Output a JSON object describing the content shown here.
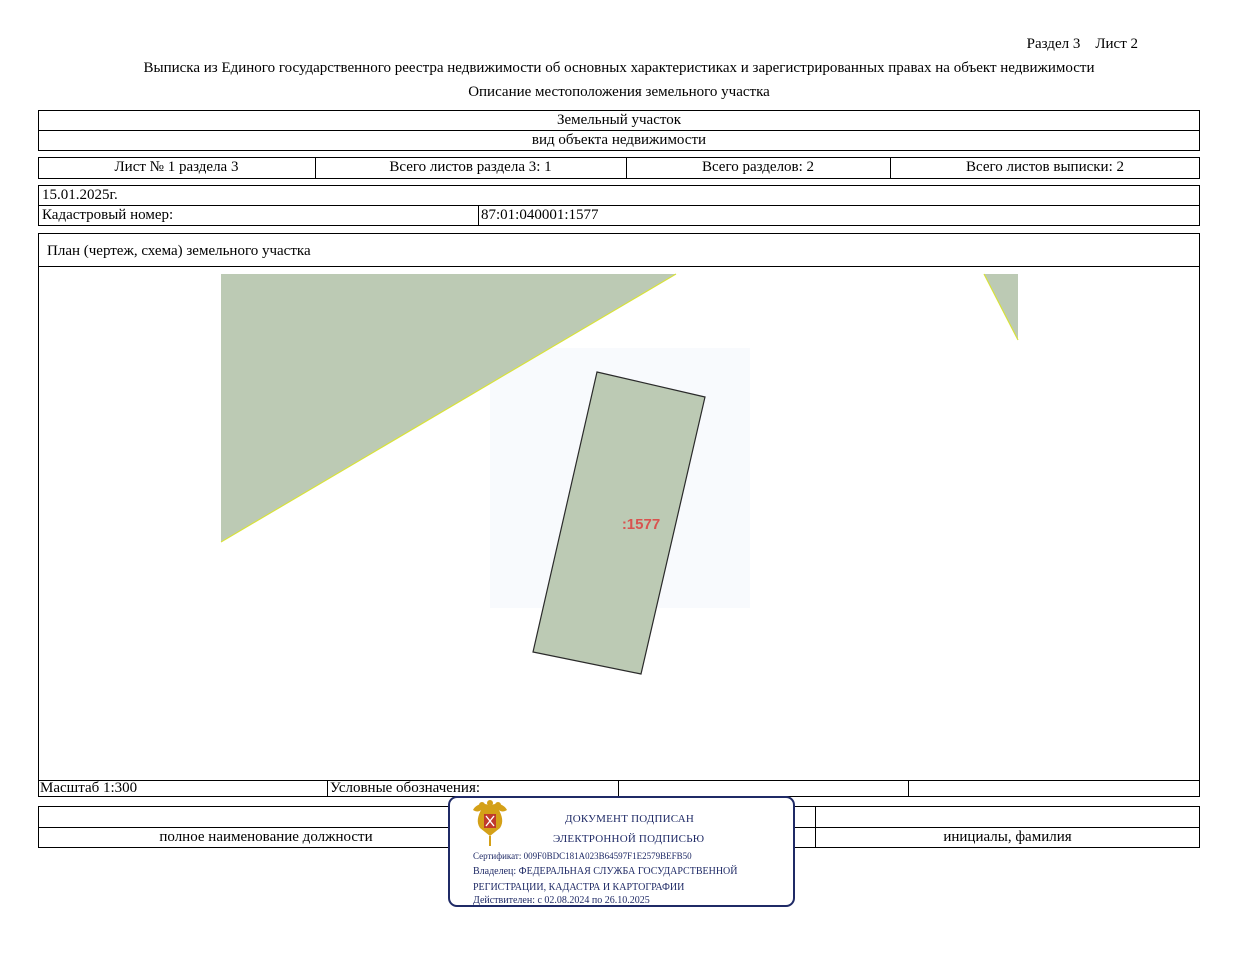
{
  "header": {
    "section_sheet": "Раздел 3    Лист 2",
    "title": "Выписка из Единого государственного реестра недвижимости об основных характеристиках и зарегистрированных правах на объект недвижимости",
    "subtitle": "Описание местоположения земельного участка"
  },
  "object": {
    "name": "Земельный участок",
    "type_caption": "вид объекта недвижимости"
  },
  "sheet_info": {
    "sheet": "Лист № 1 раздела 3",
    "total_sheets_section": "Всего листов раздела 3: 1",
    "total_sections": "Всего разделов: 2",
    "total_sheets_extract": "Всего листов выписки: 2"
  },
  "meta": {
    "date": "15.01.2025г.",
    "cadastral_label": "Кадастровый номер:",
    "cadastral_number": "87:01:040001:1577"
  },
  "plan": {
    "caption": "План (чертеж, схема) земельного участка",
    "parcel_label": ":1577",
    "fill_color": "#bccab4",
    "label_color": "#d9534f"
  },
  "footer": {
    "scale": "Масштаб 1:300",
    "legend": "Условные обозначения:",
    "position_caption": "полное наименование должности",
    "name_caption": "инициалы, фамилия"
  },
  "stamp": {
    "line1": "ДОКУМЕНТ ПОДПИСАН",
    "line2": "ЭЛЕКТРОННОЙ ПОДПИСЬЮ",
    "certificate": "Сертификат: 009F0BDC181A023B64597F1E2579BEFB50",
    "owner1": "Владелец: ФЕДЕРАЛЬНАЯ СЛУЖБА ГОСУДАРСТВЕННОЙ",
    "owner2": "РЕГИСТРАЦИИ, КАДАСТРА И КАРТОГРАФИИ",
    "validity": "Действителен: с 02.08.2024 по 26.10.2025",
    "border_color": "#1f2a66",
    "emblem": "russian-coat-of-arms-icon"
  }
}
